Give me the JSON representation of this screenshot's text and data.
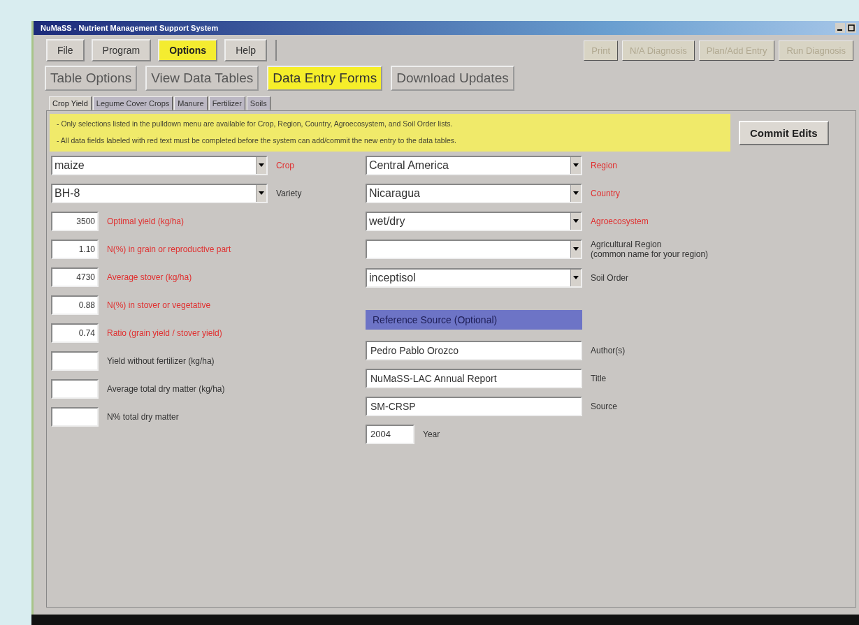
{
  "window": {
    "title": "NuMaSS - Nutrient Management Support System"
  },
  "menu": [
    {
      "label": "File",
      "selected": false
    },
    {
      "label": "Program",
      "selected": false
    },
    {
      "label": "Options",
      "selected": true
    },
    {
      "label": "Help",
      "selected": false
    }
  ],
  "toolbar_buttons": [
    {
      "label": "Print",
      "disabled": true
    },
    {
      "label": "N/A Diagnosis",
      "disabled": true
    },
    {
      "label": "Plan/Add Entry",
      "disabled": true
    },
    {
      "label": "Run Diagnosis",
      "disabled": true
    }
  ],
  "sections": [
    {
      "label": "Table Options",
      "selected": false
    },
    {
      "label": "View Data Tables",
      "selected": false
    },
    {
      "label": "Data Entry Forms",
      "selected": true
    },
    {
      "label": "Download Updates",
      "selected": false
    }
  ],
  "tabs": [
    {
      "label": "Crop Yield",
      "selected": true
    },
    {
      "label": "Legume Cover Crops",
      "selected": false
    },
    {
      "label": "Manure",
      "selected": false
    },
    {
      "label": "Fertilizer",
      "selected": false
    },
    {
      "label": "Soils",
      "selected": false
    }
  ],
  "notes": [
    "- Only selections listed in the pulldown menu are available for Crop, Region, Country, Agroecosystem, and Soil Order lists.",
    "- All data fields labeled with red text must be completed before the system can add/commit the new entry to the data tables."
  ],
  "commit_button": "Commit Edits",
  "crop_fields": [
    {
      "kind": "dropdown",
      "value": "maize",
      "label": "Crop",
      "required": true
    },
    {
      "kind": "dropdown",
      "value": "BH-8",
      "label": "Variety",
      "required": false
    },
    {
      "kind": "number",
      "value": "3500",
      "label": "Optimal yield (kg/ha)",
      "required": true
    },
    {
      "kind": "number",
      "value": "1.10",
      "label": "N(%) in grain or reproductive part",
      "required": true
    },
    {
      "kind": "number",
      "value": "4730",
      "label": "Average stover (kg/ha)",
      "required": true
    },
    {
      "kind": "number",
      "value": "0.88",
      "label": "N(%) in stover or vegetative",
      "required": true
    },
    {
      "kind": "number",
      "value": "0.74",
      "label": "Ratio (grain yield / stover yield)",
      "required": true
    },
    {
      "kind": "number",
      "label": "Yield without fertilizer (kg/ha)",
      "required": false
    },
    {
      "kind": "number",
      "label": "Average total dry matter (kg/ha)",
      "required": false
    },
    {
      "kind": "number",
      "label": "N% total dry matter",
      "required": false
    }
  ],
  "location_fields": [
    {
      "kind": "dropdown",
      "value": "Central America",
      "label": "Region",
      "required": true
    },
    {
      "kind": "dropdown",
      "value": "Nicaragua",
      "label": "Country",
      "required": true
    },
    {
      "kind": "dropdown",
      "value": "wet/dry",
      "label": "Agroecosystem",
      "required": true
    },
    {
      "kind": "dropdown",
      "label": "Agricultural Region\n(common name for your region)",
      "required": false
    },
    {
      "kind": "dropdown",
      "value": "inceptisol",
      "label": "Soil Order",
      "required": false
    }
  ],
  "reference": {
    "header": "Reference Source (Optional)",
    "fields": [
      {
        "kind": "text",
        "value": "Pedro Pablo Orozco",
        "label": "Author(s)"
      },
      {
        "kind": "text",
        "value": "NuMaSS-LAC Annual Report",
        "label": "Title"
      },
      {
        "kind": "text",
        "value": "SM-CRSP",
        "label": "Source"
      },
      {
        "kind": "year",
        "value": "2004",
        "label": "Year"
      }
    ]
  }
}
